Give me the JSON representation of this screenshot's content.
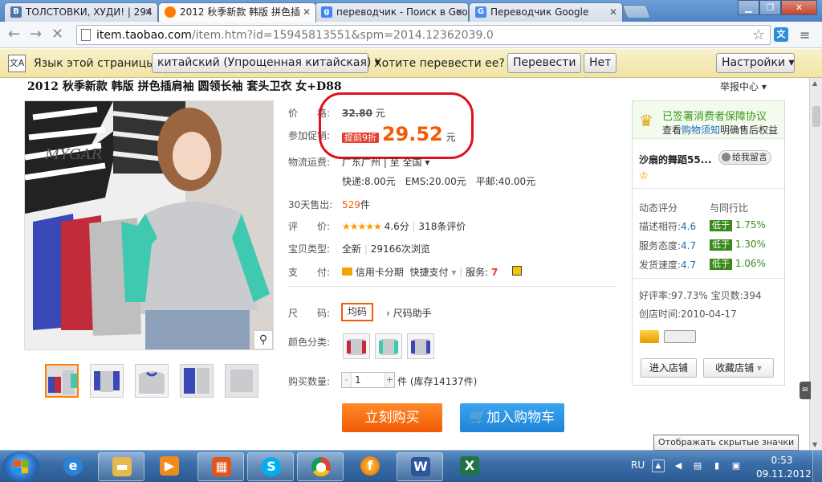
{
  "browser": {
    "tabs": [
      {
        "label": "ТОЛСТОВКИ, ХУДИ! | 294"
      },
      {
        "label": "2012 秋季新款 韩版 拼色插"
      },
      {
        "label": "переводчик - Поиск в Goo"
      },
      {
        "label": "Переводчик Google"
      }
    ],
    "url_host": "item.taobao.com",
    "url_path": "/item.htm?id=15945813551&spm=2014.12362039.0"
  },
  "translate_bar": {
    "prompt": "Язык этой страницы",
    "language": "китайский (Упрощенная китайская)",
    "question": "Хотите перевести ее?",
    "translate_label": "Перевести",
    "no_label": "Нет",
    "settings_label": "Настройки"
  },
  "product": {
    "title": "2012 秋季新款 韩版 拼色插肩袖 圆领长袖 套头卫衣 女+D88",
    "report": "举报中心",
    "price_label": "价　　格:",
    "orig_price": "32.80",
    "yuan": "元",
    "promo_label": "参加促销:",
    "promo_badge": "提前9折",
    "promo_price": "29.52",
    "shipping_label": "物流运费:",
    "shipping_from": "广东广州 | 至 全国",
    "shipping_rates": "快递:8.00元　EMS:20.00元　平邮:40.00元",
    "sold_label": "30天售出:",
    "sold_value": "529",
    "sold_unit": "件",
    "rating_label": "评　　价:",
    "rating_stars": "★★★★★",
    "rating_score": "4.6分",
    "rating_count": "318条评价",
    "type_label": "宝贝类型:",
    "type_value": "全新",
    "views": "29166次浏览",
    "pay_label": "支　　付:",
    "pay_installment": "信用卡分期",
    "pay_quick": "快捷支付",
    "service_label": "服务:",
    "size_label": "尺　　码:",
    "size_value": "均码",
    "size_helper": "尺码助手",
    "color_label": "颜色分类:",
    "qty_label": "购买数量:",
    "qty_value": "1",
    "stock": "件 (库存14137件)",
    "buy_label": "立刻购买",
    "cart_label": "加入购物车"
  },
  "seller": {
    "guarantee_title": "已签署消费者保障协议",
    "guarantee_prefix": "查看",
    "guarantee_link": "购物须知",
    "guarantee_suffix": "明确售后权益",
    "name": "沙扇的舞蹈55...",
    "message_label": "给我留言",
    "dynamic_label": "动态评分",
    "compare_label": "与同行比",
    "scores": [
      {
        "label": "描述相符:",
        "value": "4.6",
        "tag": "低于",
        "pct": "1.75%"
      },
      {
        "label": "服务态度:",
        "value": "4.7",
        "tag": "低于",
        "pct": "1.30%"
      },
      {
        "label": "发货速度:",
        "value": "4.7",
        "tag": "低于",
        "pct": "1.06%"
      }
    ],
    "good_rate": "好评率:97.73%",
    "item_count": "宝贝数:394",
    "created": "创店时间:2010-04-17",
    "enter_shop": "进入店铺",
    "fav_shop": "收藏店铺"
  },
  "taskbar": {
    "lang": "RU",
    "time": "0:53",
    "date": "09.11.2012",
    "tooltip": "Отображать скрытые значки"
  },
  "colors": {
    "accent_orange": "#f25c05",
    "annotation_red": "#e0111b",
    "cart_blue": "#1e84d8",
    "seller_green": "#3a8a1a"
  }
}
